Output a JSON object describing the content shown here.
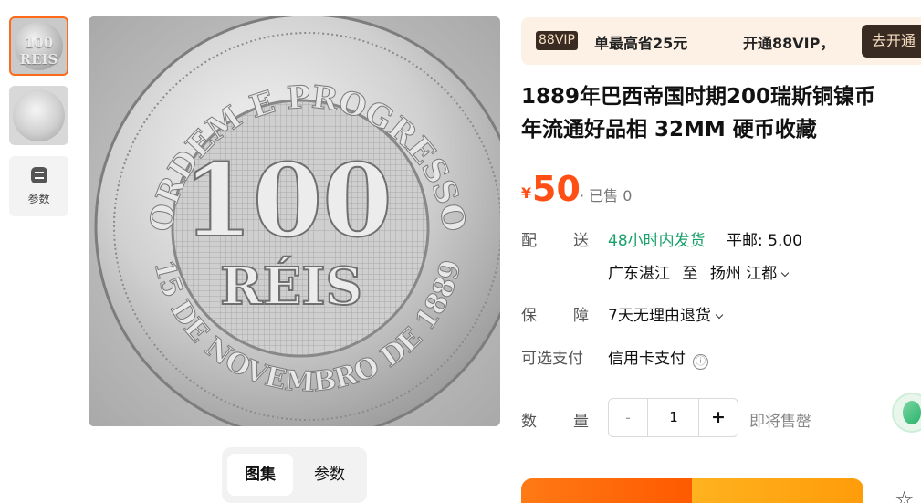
{
  "thumbnails": [
    {
      "text": "100 REIS"
    },
    {
      "text": ""
    }
  ],
  "params_button": {
    "label": "参数"
  },
  "main_image": {
    "coin_top_legend": "ORDEM E PROGRESSO",
    "coin_bottom_legend": "15 DE NOVEMBRO DE 1889",
    "coin_value": "100",
    "coin_unit": "RÉIS"
  },
  "gallery_tabs": [
    {
      "label": "图集",
      "active": true
    },
    {
      "label": "参数",
      "active": false
    }
  ],
  "vip_bar": {
    "badge": "88VIP",
    "text1": "单最高省25元",
    "text2": "开通88VIP，",
    "button": "去开通"
  },
  "product": {
    "title_line1": "1889年巴西帝国时期200瑞斯铜镍币",
    "title_line2": "年流通好品相 32MM 硬币收藏",
    "price_symbol": "¥",
    "price": "50",
    "sold": "· 已售 0"
  },
  "delivery": {
    "label": "配送",
    "speed": "48小时内发货",
    "shipping": "平邮: 5.00",
    "from": "广东湛江",
    "to_word": "至",
    "destination": "扬州 江都"
  },
  "guarantee": {
    "label": "保障",
    "value": "7天无理由退货"
  },
  "payment": {
    "label": "可选支付",
    "value": "信用卡支付",
    "info_icon": "ⓘ"
  },
  "quantity": {
    "label": "数量",
    "minus": "-",
    "value": "1",
    "plus": "+",
    "stock_note": "即将售罄"
  },
  "colors": {
    "accent": "#ff4f14",
    "green": "#19a06a",
    "vip_dark": "#3a2b22"
  }
}
